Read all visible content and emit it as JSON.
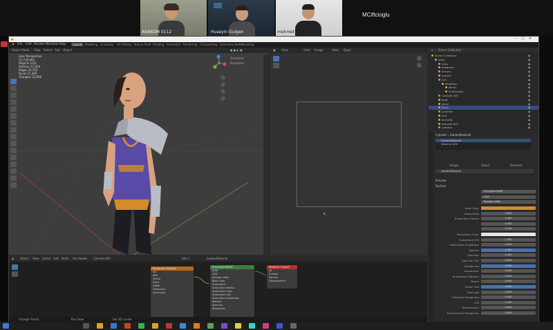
{
  "call": {
    "participants": [
      {
        "name": "AKNKOM 0112"
      },
      {
        "name": "Huseyin Gulgen"
      },
      {
        "name": "mehmet ciftcioglu"
      },
      {
        "name": "MCiftcioglu"
      }
    ]
  },
  "blender": {
    "menu": [
      "File",
      "Edit",
      "Render",
      "Window",
      "Help"
    ],
    "workspaces": [
      "Layout",
      "Modeling",
      "Sculpting",
      "UV Editing",
      "Texture Paint",
      "Shading",
      "Animation",
      "Rendering",
      "Compositing",
      "Geometry Nodes",
      "Scripting"
    ],
    "active_workspace": "Layout",
    "viewport": {
      "header": [
        "Object Mode",
        "View",
        "Select",
        "Add",
        "Object"
      ],
      "overlay_title": "User Perspective",
      "overlay_sub": "(1) Cylinder",
      "stats": [
        "Objects 1/10",
        "Vertices 11,424",
        "Edges 22,752",
        "Faces 11,369",
        "Triangles 22,656"
      ],
      "npanel": [
        "Transform",
        "Properties"
      ]
    },
    "image_editor": {
      "header": [
        "View",
        "View",
        "Image",
        "New",
        "Open"
      ]
    },
    "outliner": {
      "title": "Scene Collection",
      "rows": [
        {
          "label": "Scene Collection",
          "indent": 0,
          "sel": false
        },
        {
          "label": "body",
          "indent": 1,
          "sel": false
        },
        {
          "label": "eyes",
          "indent": 2,
          "sel": false
        },
        {
          "label": "eyebrows",
          "indent": 2,
          "sel": false
        },
        {
          "label": "armor1",
          "indent": 2,
          "sel": false
        },
        {
          "label": "armor2",
          "indent": 2,
          "sel": false
        },
        {
          "label": "hair",
          "indent": 2,
          "sel": false
        },
        {
          "label": "Modifiers",
          "indent": 3,
          "sel": false
        },
        {
          "label": "Mirror",
          "indent": 4,
          "sel": false
        },
        {
          "label": "Subdivision",
          "indent": 4,
          "sel": false
        },
        {
          "label": "Cylinder.005",
          "indent": 2,
          "sel": false
        },
        {
          "label": "boot",
          "indent": 2,
          "sel": false
        },
        {
          "label": "glove",
          "indent": 2,
          "sel": false
        },
        {
          "label": "torso",
          "indent": 2,
          "sel": true
        },
        {
          "label": "pauldron",
          "indent": 2,
          "sel": false
        },
        {
          "label": "belt",
          "indent": 2,
          "sel": false
        },
        {
          "label": "bracelet",
          "indent": 2,
          "sel": false
        },
        {
          "label": "bracelet.001",
          "indent": 2,
          "sel": false
        },
        {
          "label": "Camera",
          "indent": 2,
          "sel": false
        }
      ]
    },
    "properties": {
      "object": "Cylinder",
      "material": "GoldenMaterial",
      "slots": [
        "GoldenMaterial",
        "Material.006"
      ],
      "tabs": [
        "Assign",
        "Select",
        "Deselect"
      ],
      "section_preview": "Preview",
      "section_surface": "Surface",
      "surface_shader": "Principled BSDF",
      "distribution": "GGX",
      "subsurface_method": "Random Walk",
      "fields": [
        {
          "label": "Base Color",
          "value": "",
          "kind": "orange"
        },
        {
          "label": "Subsurface",
          "value": "0.000",
          "kind": "grey"
        },
        {
          "label": "Subsurface Radius",
          "value": "1.000",
          "kind": "grey"
        },
        {
          "label": "",
          "value": "0.200",
          "kind": "grey"
        },
        {
          "label": "",
          "value": "0.100",
          "kind": "grey"
        },
        {
          "label": "Subsurface Color",
          "value": "",
          "kind": "white"
        },
        {
          "label": "Subsurface IOR",
          "value": "1.400",
          "kind": "grey"
        },
        {
          "label": "Subsurface Anisotropy",
          "value": "0.000",
          "kind": "grey"
        },
        {
          "label": "Metallic",
          "value": "1.000",
          "kind": "blue"
        },
        {
          "label": "Specular",
          "value": "0.500",
          "kind": "grey"
        },
        {
          "label": "Specular Tint",
          "value": "0.000",
          "kind": "grey"
        },
        {
          "label": "Roughness",
          "value": "0.500",
          "kind": "blue"
        },
        {
          "label": "Anisotropic",
          "value": "0.000",
          "kind": "grey"
        },
        {
          "label": "Anisotropic Rotation",
          "value": "0.000",
          "kind": "grey"
        },
        {
          "label": "Sheen",
          "value": "0.000",
          "kind": "grey"
        },
        {
          "label": "Sheen Tint",
          "value": "0.500",
          "kind": "blue"
        },
        {
          "label": "Clearcoat",
          "value": "0.000",
          "kind": "grey"
        },
        {
          "label": "Clearcoat Roughness",
          "value": "0.030",
          "kind": "grey"
        },
        {
          "label": "IOR",
          "value": "1.450",
          "kind": "grey"
        },
        {
          "label": "Transmission",
          "value": "0.000",
          "kind": "grey"
        },
        {
          "label": "Transmission Roughness",
          "value": "0.000",
          "kind": "grey"
        }
      ]
    },
    "node_editor": {
      "header": [
        "Object",
        "View",
        "Select",
        "Add",
        "Node",
        "Use Nodes"
      ],
      "object": "Cylinder.005",
      "material": "GoldenMaterial",
      "slot": "Slot 1",
      "nodes": {
        "bump": {
          "title": "Musgrave Texture",
          "rows": [
            "3D",
            "fBM",
            "Vector",
            "Scale",
            "Detail",
            "Dimension",
            "Lacunarity"
          ]
        },
        "bsdf": {
          "title": "Principled BSDF",
          "rows": [
            "BSDF",
            "GGX",
            "Random Walk",
            "Base Color",
            "Subsurface",
            "Subsurface Radius",
            "Subsurface Color",
            "Subsurface IOR",
            "Subsurface Anisotropy",
            "Metallic",
            "Specular",
            "Roughness"
          ]
        },
        "output": {
          "title": "Material Output",
          "rows": [
            "All",
            "Surface",
            "Volume",
            "Displacement"
          ]
        }
      }
    },
    "statusbar": [
      "Change Frame",
      "Pan View",
      "Set 3D Cursor"
    ]
  },
  "colors": {
    "armor_purple": "#5a4aa8",
    "skin": "#d9a27f",
    "metal": "#b8bcc4",
    "gold": "#d68a2a",
    "selection_blue": "#4772b3",
    "bsdf_header": "#3b7d3b",
    "texture_header": "#b56a1e",
    "output_header": "#b53030"
  }
}
